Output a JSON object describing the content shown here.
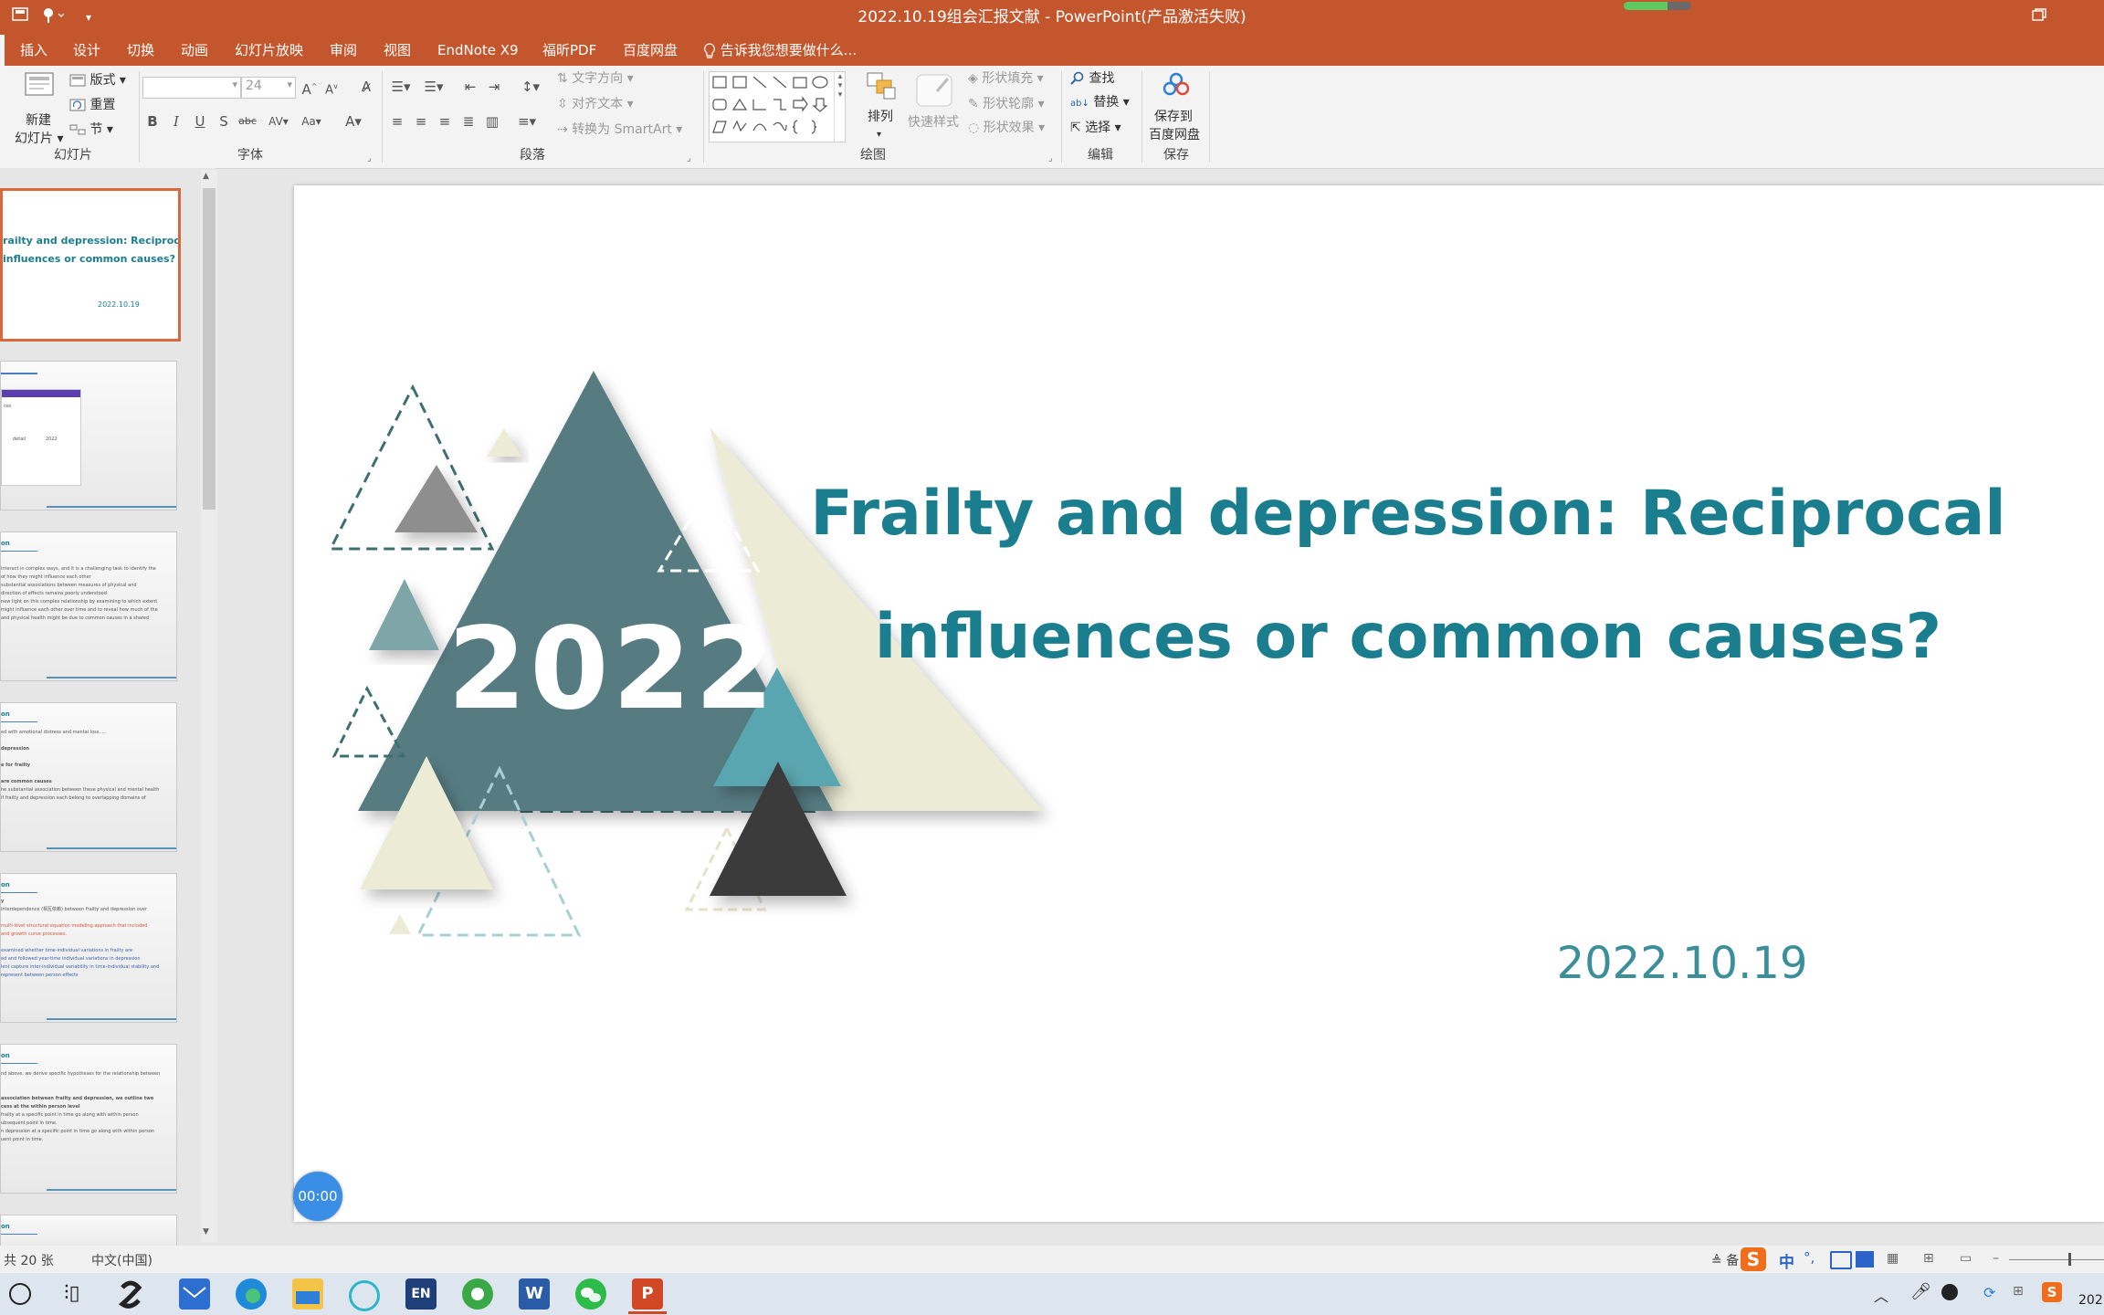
{
  "window": {
    "title": "2022.10.19组会汇报文献 - PowerPoint(产品激活失败)",
    "progress_fraction": 0.65,
    "colors": {
      "titlebar": "#c4562d",
      "accent": "#1b7e8f"
    }
  },
  "quick_access": {
    "icons": [
      "save-icon",
      "touch-mode-icon",
      "customize-icon"
    ]
  },
  "tabs": [
    "插入",
    "设计",
    "切换",
    "动画",
    "幻灯片放映",
    "审阅",
    "视图",
    "EndNote X9",
    "福昕PDF",
    "百度网盘"
  ],
  "tell_me": "告诉我您想要做什么...",
  "ribbon": {
    "slides": {
      "new_slide_line1": "新建",
      "new_slide_line2": "幻灯片",
      "layout": "版式",
      "reset": "重置",
      "section": "节",
      "group": "幻灯片"
    },
    "font": {
      "font_size": "24",
      "group": "字体"
    },
    "paragraph": {
      "text_direction": "文字方向",
      "align_text": "对齐文本",
      "smartart": "转换为 SmartArt",
      "group": "段落"
    },
    "drawing": {
      "arrange": "排列",
      "quick_styles": "快速样式",
      "shape_fill": "形状填充",
      "shape_outline": "形状轮廓",
      "shape_effects": "形状效果",
      "group": "绘图"
    },
    "editing": {
      "find": "查找",
      "replace": "替换",
      "select": "选择",
      "group": "编辑"
    },
    "save": {
      "line1": "保存到",
      "line2": "百度网盘",
      "group": "保存"
    }
  },
  "thumbnails": [
    {
      "title_line1": "railty and depression: Reciprocal",
      "title_line2": "influences or common causes?",
      "date": "2022.10.19",
      "selected": true
    },
    {
      "text": [
        "ces",
        "",
        "detail",
        "",
        "2022"
      ],
      "selected": false
    },
    {
      "heading": "on",
      "text": [
        "interact in complex ways, and it is a challenging task to identify the",
        "of how they might influence each other",
        "substantial associations between measures of physical and",
        "direction of effects remains poorly understood",
        "new light on this complex relationship by examining to which extent",
        "might influence each other over time and to reveal how much of the",
        "and physical health might be due to common causes in a shared"
      ],
      "selected": false
    },
    {
      "heading": "on",
      "text": [
        "ed with emotional distress and mental loss.....",
        "",
        "depression",
        "",
        "e for frailty",
        "",
        "are common causes",
        "he substantial association between these physical and mental health",
        "if frailty and depression each belong to overlapping domains of"
      ],
      "selected": false
    },
    {
      "heading": "on",
      "text": [
        "y",
        "interdependence (相互依赖) between frailty and depression over",
        "",
        "multi-level structural equation modeling approach that included",
        "and growth curve processes.",
        "",
        "examined whether time-individual variations in frailty are",
        "ed and followed year-time individual variations in depression",
        "lent capture inter-individual variability in time-individual stability and",
        "represent between person effects"
      ],
      "selected": false
    },
    {
      "heading": "on",
      "text": [
        "nd above, we derive specific hypotheses for the relationship between",
        "",
        "",
        "association between frailty and depression, we outline two",
        "cess at the within person level",
        "frailty at a specific point in time go along with within person",
        "ubsequent point in time.",
        "n depression at a specific point in time go along with within person",
        "uent point in time."
      ],
      "selected": false
    },
    {
      "heading": "on",
      "text": [],
      "selected": false
    }
  ],
  "slide": {
    "year": "2022",
    "title_line1": "Frailty and depression: Reciprocal",
    "title_line2": "influences or common causes?",
    "date": "2022.10.19",
    "timer": "00:00"
  },
  "statusbar": {
    "slide_count": "共 20 张",
    "language": "中文(中国)",
    "notes": "备",
    "ime_mode": "中",
    "ime_punct": "°,"
  },
  "taskbar": {
    "apps": [
      "start-circle-icon",
      "task-view-icon",
      "sogou-app-icon",
      "mail-app-icon",
      "edge-browser-icon",
      "file-explorer-icon",
      "app-icon-teal",
      "endnote-app-icon",
      "ie-browser-icon",
      "word-app-icon",
      "wechat-app-icon",
      "powerpoint-app-icon"
    ],
    "endnote_label": "EN",
    "word_label": "W",
    "ppt_label": "P",
    "clock": "202"
  }
}
